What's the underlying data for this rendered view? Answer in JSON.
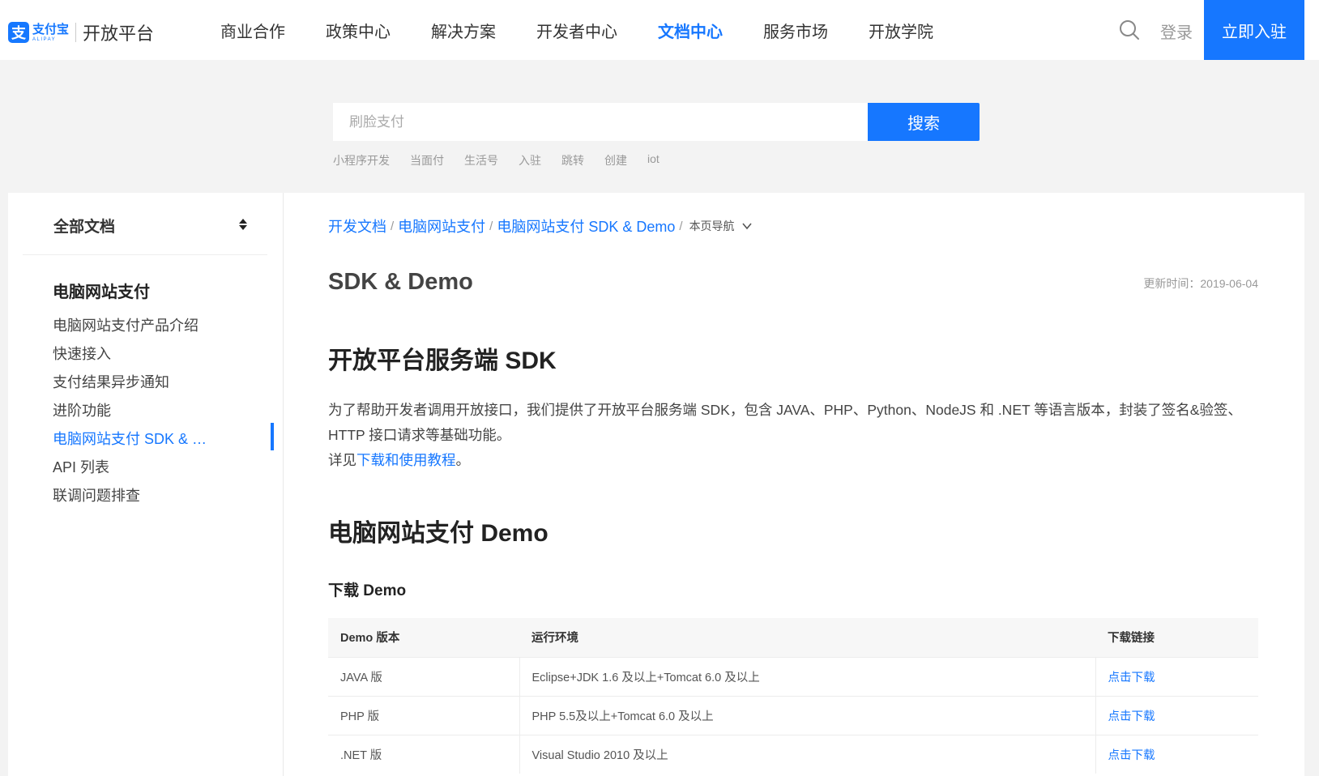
{
  "header": {
    "logo_cn": "支付宝",
    "logo_en": "ALIPAY",
    "title": "开放平台",
    "nav": [
      {
        "label": "商业合作",
        "active": false
      },
      {
        "label": "政策中心",
        "active": false
      },
      {
        "label": "解决方案",
        "active": false
      },
      {
        "label": "开发者中心",
        "active": false
      },
      {
        "label": "文档中心",
        "active": true
      },
      {
        "label": "服务市场",
        "active": false
      },
      {
        "label": "开放学院",
        "active": false
      }
    ],
    "login_label": "登录",
    "join_label": "立即入驻"
  },
  "search": {
    "placeholder": "刷脸支付",
    "button_label": "搜索",
    "hot_tags": [
      "小程序开发",
      "当面付",
      "生活号",
      "入驻",
      "跳转",
      "创建",
      "iot"
    ]
  },
  "sidebar": {
    "title": "全部文档",
    "group": "电脑网站支付",
    "items": [
      {
        "label": "电脑网站支付产品介绍",
        "active": false
      },
      {
        "label": "快速接入",
        "active": false
      },
      {
        "label": "支付结果异步通知",
        "active": false
      },
      {
        "label": "进阶功能",
        "active": false
      },
      {
        "label": "电脑网站支付 SDK & Demo",
        "active": true
      },
      {
        "label": "API 列表",
        "active": false
      },
      {
        "label": "联调问题排查",
        "active": false
      }
    ]
  },
  "breadcrumb": {
    "items": [
      "开发文档",
      "电脑网站支付",
      "电脑网站支付 SDK & Demo"
    ],
    "page_nav": "本页导航"
  },
  "content": {
    "title": "SDK & Demo",
    "updated_label": "更新时间：",
    "updated_date": "2019-06-04",
    "sdk_heading": "开放平台服务端 SDK",
    "sdk_text": "为了帮助开发者调用开放接口，我们提供了开放平台服务端 SDK，包含 JAVA、PHP、Python、NodeJS 和 .NET 等语言版本，封装了签名&验签、HTTP 接口请求等基础功能。",
    "see_prefix": "详见",
    "see_link": "下载和使用教程",
    "see_suffix": "。",
    "demo_heading": "电脑网站支付 Demo",
    "download_heading": "下载 Demo",
    "table": {
      "headers": [
        "Demo 版本",
        "运行环境",
        "下载链接"
      ],
      "rows": [
        {
          "version": "JAVA 版",
          "env": "Eclipse+JDK 1.6 及以上+Tomcat 6.0 及以上",
          "link": "点击下载"
        },
        {
          "version": "PHP 版",
          "env": "PHP 5.5及以上+Tomcat 6.0 及以上",
          "link": "点击下载"
        },
        {
          "version": ".NET 版",
          "env": "Visual Studio 2010 及以上",
          "link": "点击下载"
        }
      ]
    }
  }
}
